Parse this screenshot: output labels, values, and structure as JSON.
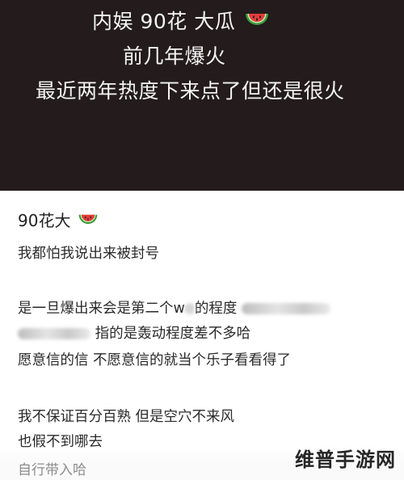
{
  "header": {
    "line1": "内娱 90花 大瓜",
    "line2": "前几年爆火",
    "line3": "最近两年热度下来点了但还是很火",
    "emoji_icon": "watermelon-icon"
  },
  "post": {
    "title": "90花大",
    "title_emoji_icon": "watermelon-icon",
    "p1": "我都怕我说出来被封号",
    "p2_visible_start": "是一旦爆出来会是第二个",
    "p2_partial": "w",
    "p2_mid": "的程度",
    "p3_tail": "指的是轰动程度差不多哈",
    "p4": "愿意信的信 不愿意信的就当个乐子看看得了",
    "p5": "我不保证百分百熟 但是空穴不来风",
    "p6": "也假不到哪去",
    "p7": "自行带入哈"
  },
  "watermark": "维普手游网",
  "colors": {
    "header_bg": "#231b1c",
    "header_text": "#f5f5f5",
    "body_text": "#2a2a2a",
    "muted_text": "#8c8c8c"
  }
}
